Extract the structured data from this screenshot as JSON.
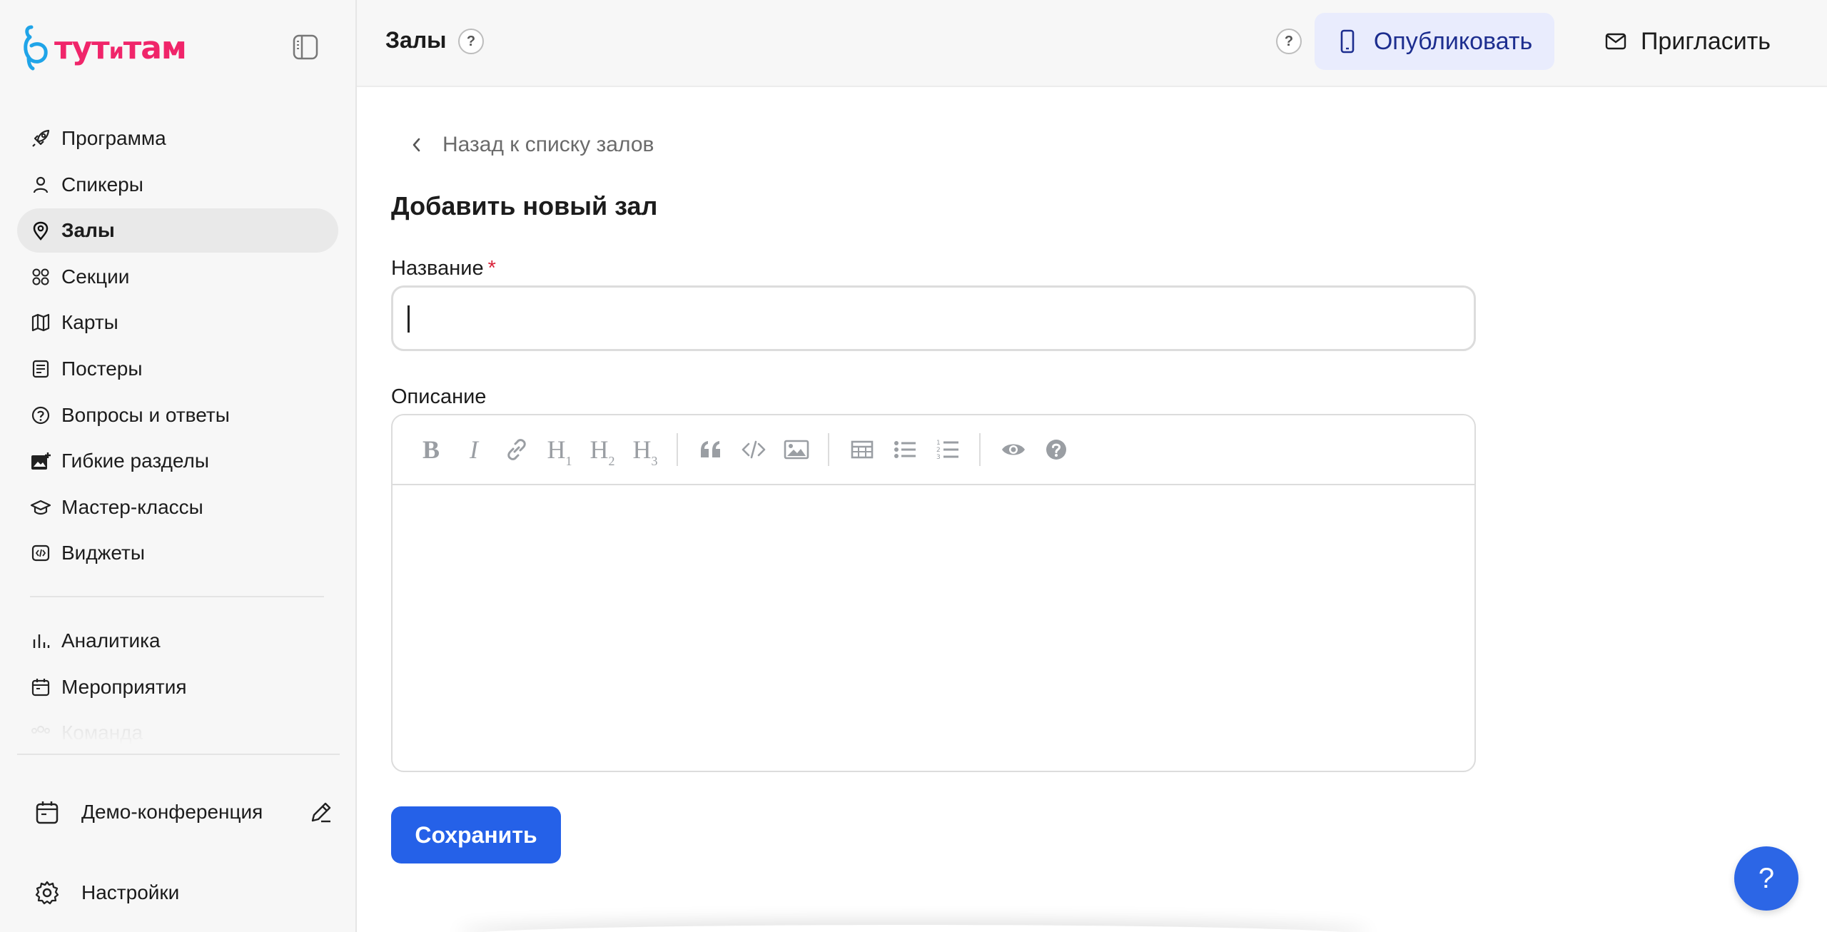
{
  "brand": {
    "logo_main": "тут",
    "logo_mid": "и",
    "logo_end": "там",
    "color": "#f0256a"
  },
  "sidebar": {
    "items": [
      {
        "label": "Программа",
        "icon": "rocket-icon"
      },
      {
        "label": "Спикеры",
        "icon": "user-icon"
      },
      {
        "label": "Залы",
        "icon": "map-pin-icon",
        "active": true
      },
      {
        "label": "Секции",
        "icon": "grid-circles-icon"
      },
      {
        "label": "Карты",
        "icon": "map-icon"
      },
      {
        "label": "Постеры",
        "icon": "poster-icon"
      },
      {
        "label": "Вопросы и ответы",
        "icon": "question-circle-icon"
      },
      {
        "label": "Гибкие разделы",
        "icon": "image-plus-icon"
      },
      {
        "label": "Мастер-классы",
        "icon": "graduation-cap-icon"
      },
      {
        "label": "Виджеты",
        "icon": "code-icon"
      }
    ],
    "items2": [
      {
        "label": "Аналитика",
        "icon": "bar-chart-icon"
      },
      {
        "label": "Мероприятия",
        "icon": "calendar-icon"
      },
      {
        "label": "Команда",
        "icon": "team-icon"
      }
    ],
    "event_name": "Демо-конференция",
    "settings_label": "Настройки"
  },
  "header": {
    "title": "Залы",
    "help_glyph": "?",
    "publish_label": "Опубликовать",
    "invite_label": "Пригласить"
  },
  "main": {
    "back_label": "Назад к списку залов",
    "form_title": "Добавить новый зал",
    "name_label": "Название",
    "required_mark": "*",
    "name_value": "",
    "description_label": "Описание",
    "toolbar": {
      "bold": "B",
      "italic": "I",
      "h1": "H",
      "h1_sub": "1",
      "h2": "H",
      "h2_sub": "2",
      "h3": "H",
      "h3_sub": "3"
    },
    "save_label": "Сохранить"
  },
  "help_fab": "?",
  "colors": {
    "accent": "#2561e8",
    "publish_bg": "#e9ecfd",
    "publish_text": "#1d2e8f",
    "required": "#d9233a"
  }
}
